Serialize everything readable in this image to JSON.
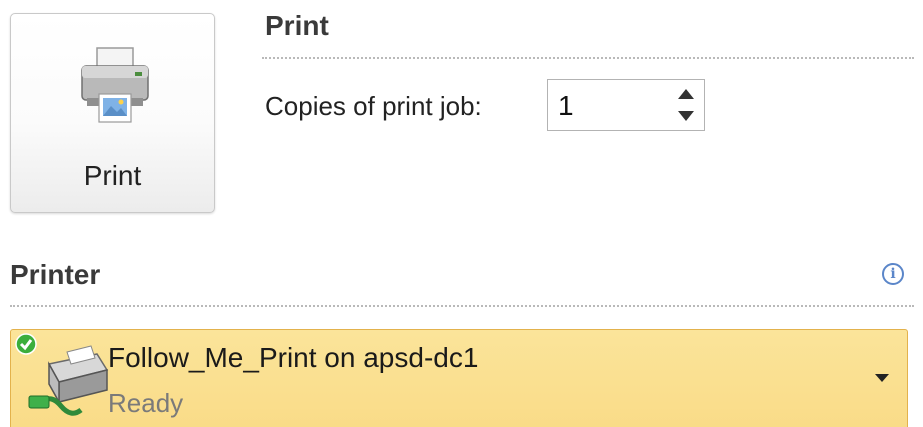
{
  "print_button": {
    "label": "Print",
    "icon": "printer-icon"
  },
  "print_section": {
    "title": "Print",
    "copies_label": "Copies of print job:",
    "copies_value": "1"
  },
  "printer_section": {
    "title": "Printer",
    "info_icon": "info-icon",
    "info_glyph": "i",
    "selected_printer": {
      "name": "Follow_Me_Print on apsd-dc1",
      "status": "Ready",
      "icon": "network-printer-icon",
      "status_icon": "ready-check-icon"
    }
  },
  "colors": {
    "selected_printer_background": "#fbe49a",
    "selected_printer_border": "#e3b24c",
    "info_icon": "#5b86c9",
    "ready_check": "#3cae3c"
  }
}
